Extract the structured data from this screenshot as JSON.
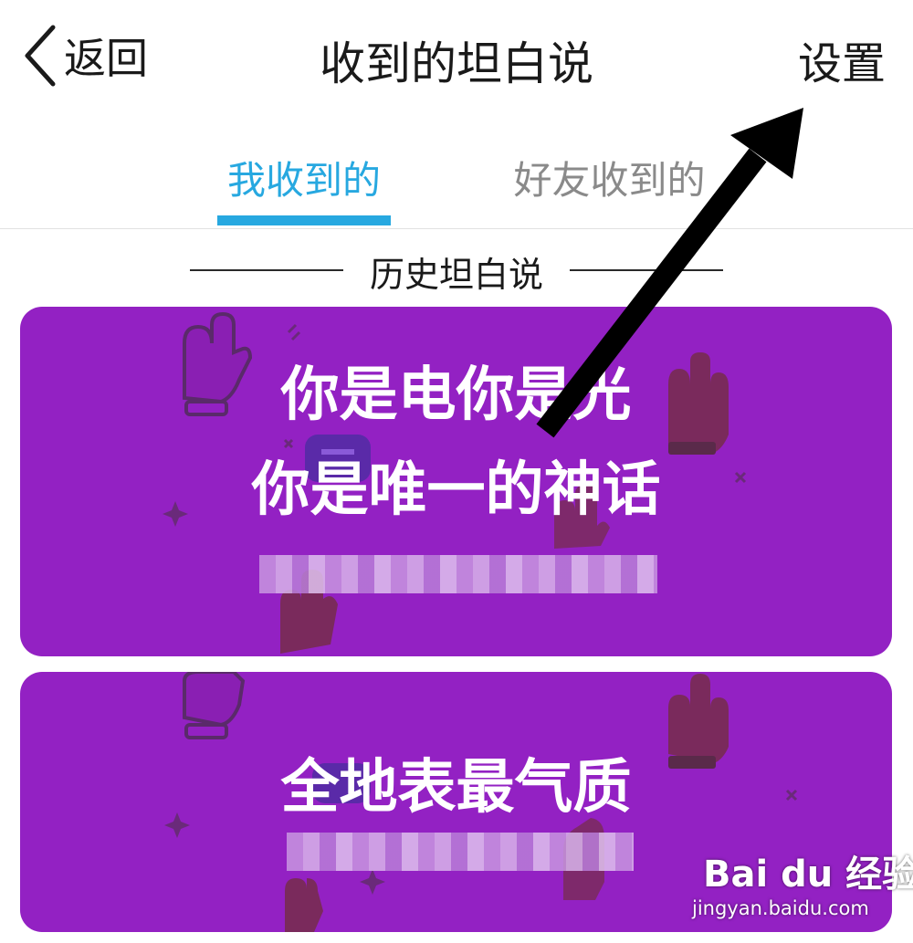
{
  "header": {
    "back_label": "返回",
    "title": "收到的坦白说",
    "settings_label": "设置"
  },
  "tabs": [
    {
      "label": "我收到的",
      "active": true
    },
    {
      "label": "好友收到的",
      "active": false
    }
  ],
  "section_label": "历史坦白说",
  "cards": [
    {
      "line1": "你是电你是光",
      "line2": "你是唯一的神话",
      "sender": "(blurred)"
    },
    {
      "line1": "全地表最气质",
      "sender": "(blurred)"
    }
  ],
  "watermark": {
    "logo": "Bai du 经验",
    "url": "jingyan.baidu.com"
  },
  "colors": {
    "accent": "#27a8e0",
    "card_background": "#9321c3",
    "decor_icon": "#6a2a7a",
    "arrow": "#000000"
  },
  "icons": [
    "chevron-left-icon",
    "hand-gesture-icon",
    "sparkle-icon",
    "speech-bubble-icon",
    "arrow-annotation"
  ]
}
